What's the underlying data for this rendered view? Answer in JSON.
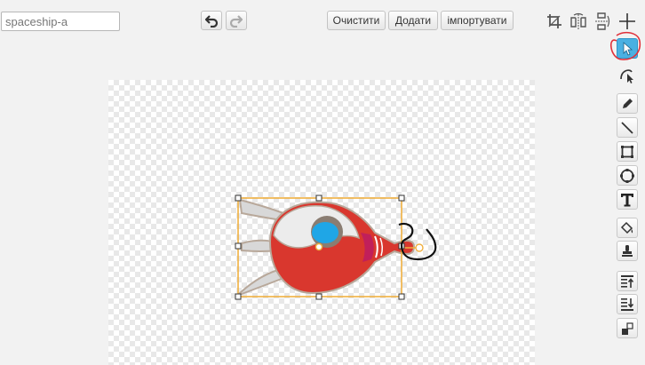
{
  "costume_name": {
    "value": "spaceship-a"
  },
  "toolbar": {
    "undo_icon": "undo-arrow",
    "redo_icon": "redo-arrow",
    "clear_label": "Очистити",
    "add_label": "Додати",
    "import_label": "імпортувати"
  },
  "top_tools": [
    {
      "name": "crop-icon"
    },
    {
      "name": "flip-horizontal-icon"
    },
    {
      "name": "flip-vertical-icon"
    },
    {
      "name": "set-center-icon"
    }
  ],
  "side_tools": [
    {
      "name": "select-tool",
      "icon": "arrow-cursor",
      "selected": true
    },
    {
      "name": "reshape-tool",
      "icon": "reshape",
      "selected": false
    },
    {
      "name": "pencil-tool",
      "icon": "pencil",
      "selected": false
    },
    {
      "name": "line-tool",
      "icon": "line",
      "selected": false
    },
    {
      "name": "rectangle-tool",
      "icon": "rectangle",
      "selected": false
    },
    {
      "name": "ellipse-tool",
      "icon": "ellipse",
      "selected": false
    },
    {
      "name": "text-tool",
      "icon": "letter-T",
      "selected": false
    },
    {
      "name": "fill-tool",
      "icon": "paint-bucket",
      "selected": false
    },
    {
      "name": "stamp-tool",
      "icon": "stamp",
      "selected": false
    },
    {
      "name": "bring-forward-tool",
      "icon": "layer-up",
      "selected": false
    },
    {
      "name": "send-backward-tool",
      "icon": "layer-down",
      "selected": false
    },
    {
      "name": "ungroup-tool",
      "icon": "ungroup",
      "selected": false
    }
  ],
  "colors": {
    "selection": "#f0b040",
    "selected_tool": "#4ab0e2",
    "annotation": "#e0303a",
    "ship_red": "#d9372e",
    "ship_window": "#1fa6e6"
  }
}
